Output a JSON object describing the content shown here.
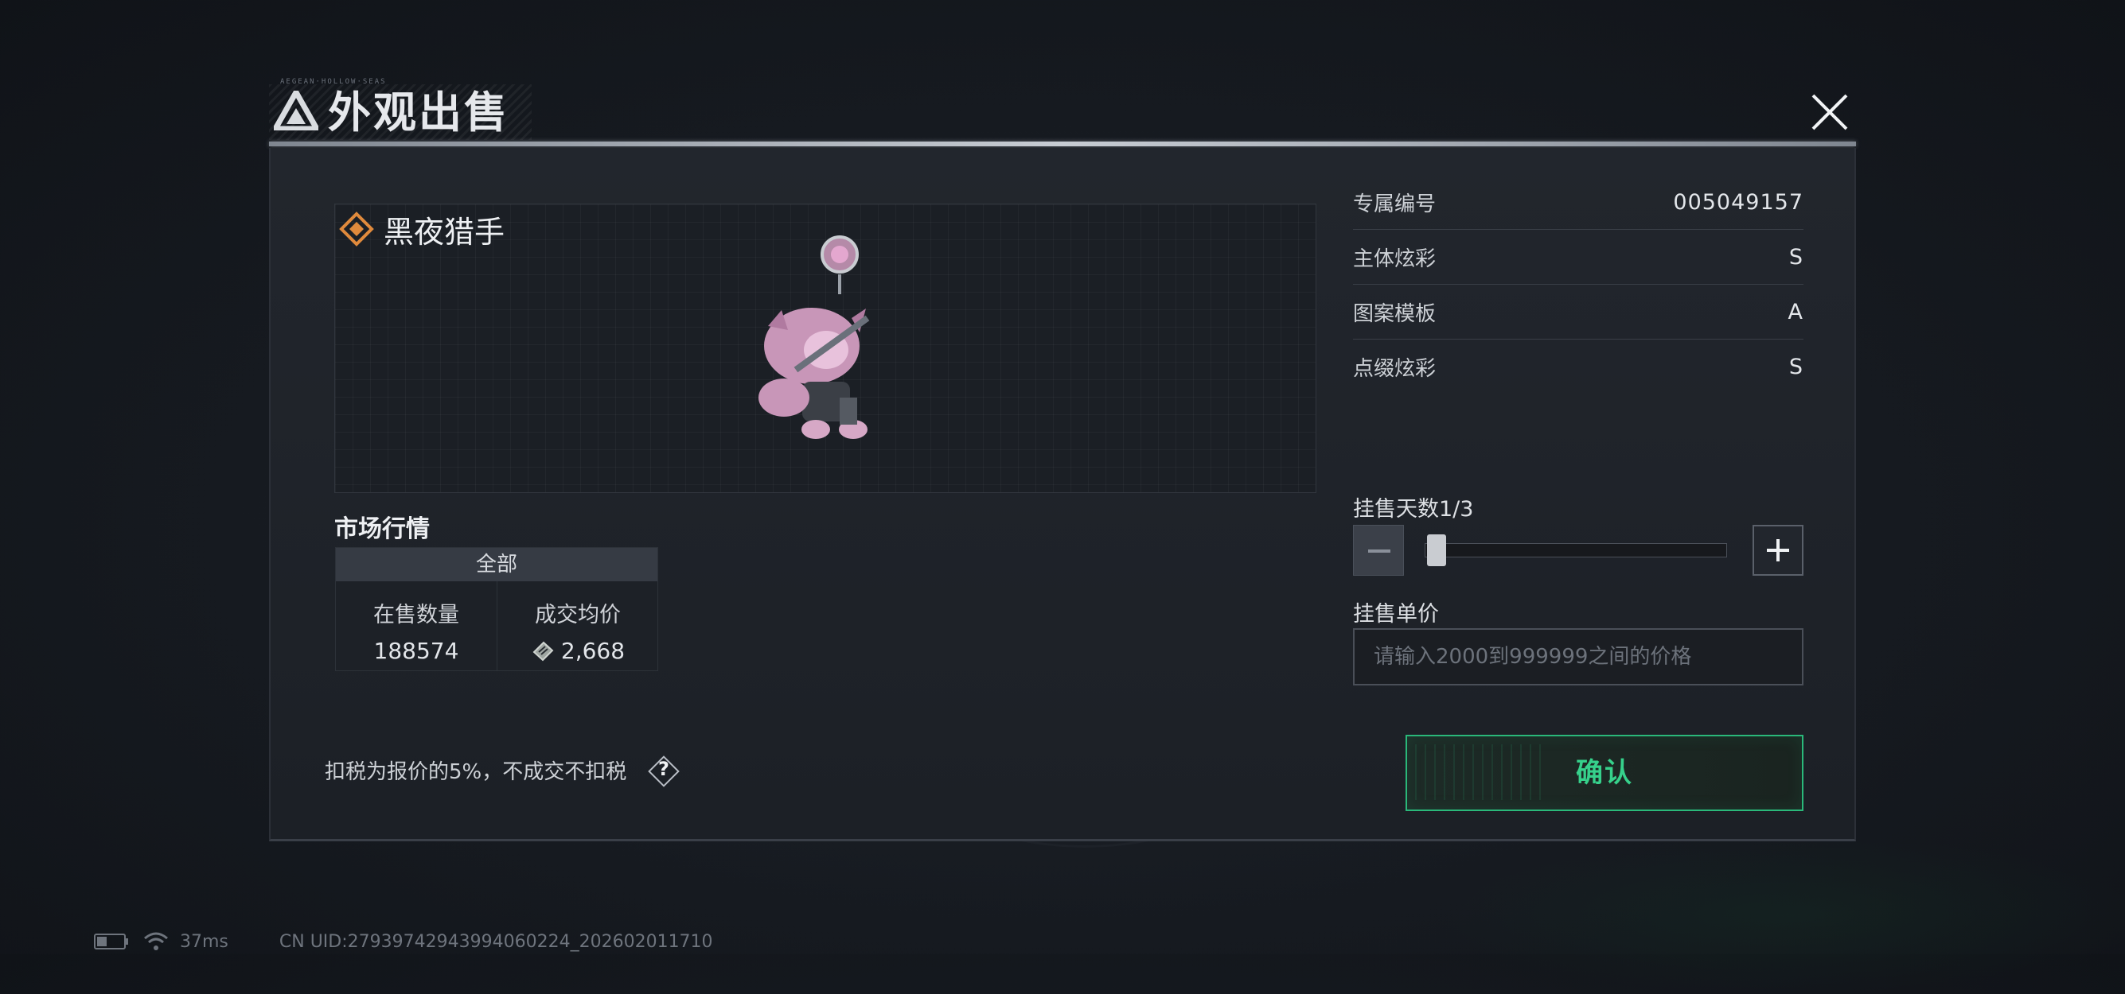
{
  "dialog": {
    "title": "外观出售",
    "title_mini": "AEGEAN·HOLLOW·SEAS"
  },
  "item": {
    "name": "黑夜猎手",
    "rarity_icon": "diamond-rarity-icon",
    "rarity_color": "#e08a3c"
  },
  "market": {
    "title": "市场行情",
    "tab_label": "全部",
    "on_sale_label": "在售数量",
    "on_sale_value": "188574",
    "avg_price_label": "成交均价",
    "avg_price_value": "2,668",
    "currency_icon": "ticket-coin-icon"
  },
  "attributes": [
    {
      "key": "专属编号",
      "value": "005049157"
    },
    {
      "key": "主体炫彩",
      "value": "S"
    },
    {
      "key": "图案模板",
      "value": "A"
    },
    {
      "key": "点缀炫彩",
      "value": "S"
    }
  ],
  "listing": {
    "days_label": "挂售天数1/3",
    "days_current": 1,
    "days_max": 3,
    "price_label": "挂售单价",
    "price_placeholder": "请输入2000到999999之间的价格",
    "price_value": ""
  },
  "footer": {
    "tax_note": "扣税为报价的5%，不成交不扣税",
    "help_label": "?",
    "confirm_label": "确认"
  },
  "status_bar": {
    "ping": "37ms",
    "uid": "CN UID:27939742943994060224_202602011710"
  },
  "colors": {
    "accent_green": "#36d18b",
    "rarity_orange": "#e08a3c"
  }
}
